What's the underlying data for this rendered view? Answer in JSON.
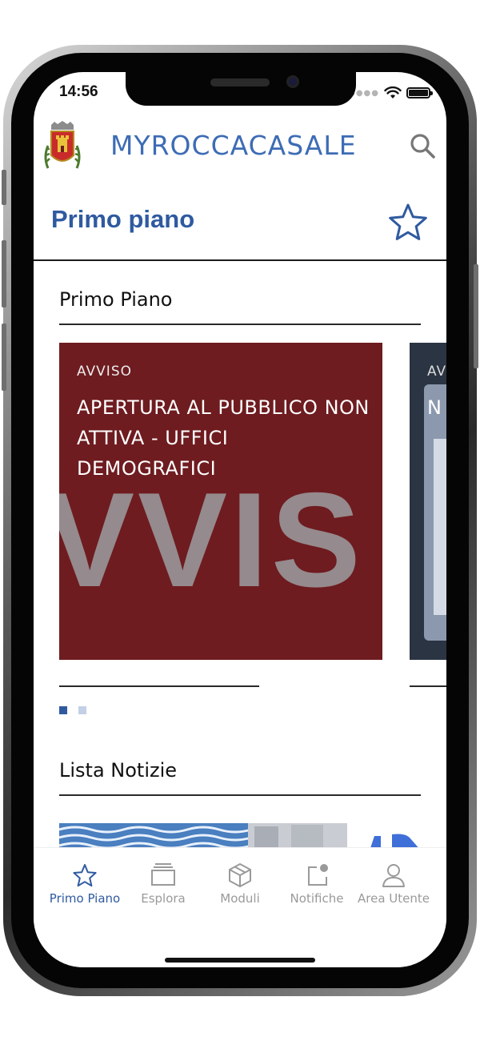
{
  "status_bar": {
    "time": "14:56"
  },
  "header": {
    "brand": "MYROCCACASALE",
    "crest_icon": "municipal-crest-icon",
    "search_icon": "search-icon"
  },
  "page": {
    "title": "Primo piano",
    "favorite_icon": "star-outline-icon"
  },
  "featured": {
    "section_title": "Primo Piano",
    "cards": [
      {
        "category": "AVVISO",
        "title": "APERTURA AL PUBBLICO NON ATTIVA - UFFICI DEMOGRAFICI",
        "background_text": "VVIS"
      },
      {
        "category": "AV",
        "title": "N sc"
      }
    ],
    "pagination": {
      "current_page": 1,
      "total_pages": 2
    }
  },
  "news": {
    "section_title": "Lista Notizie"
  },
  "tab_bar": {
    "tabs": [
      {
        "label": "Primo Piano",
        "icon": "star-icon",
        "active": true
      },
      {
        "label": "Esplora",
        "icon": "stack-icon",
        "active": false
      },
      {
        "label": "Moduli",
        "icon": "cube-icon",
        "active": false
      },
      {
        "label": "Notifiche",
        "icon": "notification-icon",
        "active": false
      },
      {
        "label": "Area Utente",
        "icon": "user-icon",
        "active": false
      }
    ]
  },
  "colors": {
    "brand_blue": "#2f5aa0",
    "card_red": "#6e1c20",
    "inactive_gray": "#9a9a9a"
  }
}
